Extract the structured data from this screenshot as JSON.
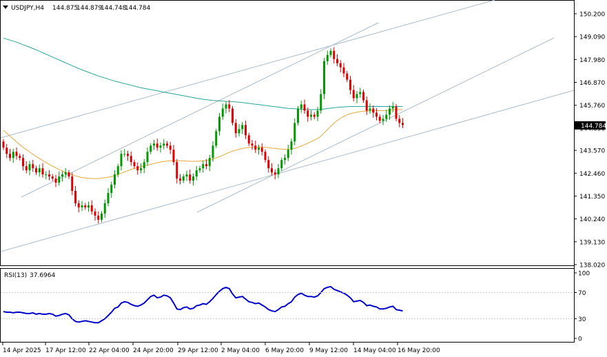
{
  "header": {
    "symbol": "USDJPY,H4",
    "open": "144.875",
    "high": "144.879",
    "low": "144.748",
    "close": "144.784"
  },
  "rsi_header": {
    "label": "RSI(13)",
    "value": "37.6964"
  },
  "current_price": "144.784",
  "colors": {
    "bull": "#009900",
    "bear": "#dd0000",
    "ma_fast": "#e8a83a",
    "ma_slow": "#26a69a",
    "trend": "#a9bccb",
    "rsi": "#0000cc",
    "price_box": "#000000"
  },
  "chart_data": {
    "type": "candlestick",
    "price_axis": {
      "ylim": [
        138.02,
        150.6
      ],
      "ticks": [
        "150.200",
        "149.090",
        "147.980",
        "146.870",
        "145.760",
        "144.650",
        "143.570",
        "142.460",
        "141.350",
        "140.240",
        "139.130",
        "138.020"
      ]
    },
    "rsi_axis": {
      "ylim": [
        0,
        100
      ],
      "ticks": [
        "100",
        "70",
        "30",
        "0"
      ]
    },
    "time_axis": {
      "labels": [
        "14 Apr 2025",
        "17 Apr 12:00",
        "22 Apr 04:00",
        "24 Apr 20:00",
        "29 Apr 12:00",
        "2 May 04:00",
        "6 May 20:00",
        "9 May 12:00",
        "14 May 04:00",
        "16 May 20:00"
      ]
    },
    "close": [
      143.7,
      143.4,
      143.2,
      143.5,
      143.3,
      143.2,
      142.8,
      142.6,
      142.9,
      142.7,
      142.5,
      142.7,
      142.4,
      142.4,
      142.3,
      142.2,
      142.0,
      142.3,
      142.4,
      142.5,
      142.3,
      141.6,
      141.0,
      140.8,
      140.9,
      140.8,
      140.9,
      140.6,
      140.4,
      140.2,
      140.5,
      141.0,
      141.5,
      141.9,
      142.4,
      142.8,
      143.4,
      143.4,
      143.3,
      143.0,
      142.8,
      142.6,
      142.7,
      143.0,
      143.5,
      143.8,
      143.9,
      143.7,
      143.8,
      143.9,
      143.8,
      143.6,
      143.0,
      142.2,
      142.1,
      142.3,
      142.4,
      142.1,
      142.3,
      142.6,
      142.7,
      142.9,
      142.8,
      143.2,
      143.8,
      144.5,
      145.2,
      145.6,
      145.8,
      145.6,
      144.9,
      144.4,
      144.6,
      144.8,
      144.3,
      143.9,
      143.8,
      143.6,
      143.7,
      143.5,
      143.1,
      142.7,
      142.5,
      142.4,
      142.7,
      143.1,
      143.2,
      143.6,
      144.0,
      144.9,
      145.6,
      145.8,
      145.5,
      145.2,
      145.3,
      145.2,
      145.5,
      146.3,
      147.9,
      148.2,
      148.4,
      148.0,
      147.8,
      147.6,
      147.3,
      147.0,
      146.5,
      146.1,
      146.3,
      146.4,
      146.0,
      145.5,
      145.6,
      145.4,
      145.2,
      145.0,
      145.1,
      145.3,
      145.6,
      145.7,
      145.1,
      144.9,
      144.8
    ],
    "ma_fast": [
      144.55,
      144.4,
      144.26,
      144.12,
      143.98,
      143.85,
      143.72,
      143.6,
      143.49,
      143.38,
      143.27,
      143.17,
      143.07,
      142.98,
      142.89,
      142.8,
      142.72,
      142.64,
      142.57,
      142.5,
      142.44,
      142.38,
      142.33,
      142.29,
      142.25,
      142.23,
      142.21,
      142.2,
      142.2,
      142.2,
      142.22,
      142.24,
      142.27,
      142.3,
      142.35,
      142.4,
      142.46,
      142.52,
      142.58,
      142.64,
      142.69,
      142.73,
      142.77,
      142.81,
      142.85,
      142.89,
      142.93,
      142.97,
      143.0,
      143.03,
      143.05,
      143.06,
      143.07,
      143.07,
      143.06,
      143.06,
      143.05,
      143.04,
      143.04,
      143.04,
      143.05,
      143.06,
      143.08,
      143.11,
      143.15,
      143.2,
      143.26,
      143.33,
      143.4,
      143.47,
      143.53,
      143.58,
      143.62,
      143.66,
      143.69,
      143.71,
      143.72,
      143.73,
      143.73,
      143.73,
      143.72,
      143.7,
      143.68,
      143.66,
      143.64,
      143.63,
      143.62,
      143.62,
      143.64,
      143.67,
      143.72,
      143.78,
      143.85,
      143.92,
      143.99,
      144.07,
      144.15,
      144.26,
      144.42,
      144.58,
      144.74,
      144.89,
      145.02,
      145.13,
      145.22,
      145.29,
      145.35,
      145.39,
      145.42,
      145.45,
      145.47,
      145.48,
      145.49,
      145.5,
      145.5,
      145.5,
      145.5,
      145.51,
      145.52,
      145.54,
      145.55,
      145.55,
      145.55
    ],
    "ma_slow": [
      149.02,
      148.97,
      148.92,
      148.87,
      148.82,
      148.76,
      148.7,
      148.64,
      148.58,
      148.51,
      148.45,
      148.38,
      148.31,
      148.24,
      148.17,
      148.1,
      148.03,
      147.96,
      147.89,
      147.82,
      147.75,
      147.68,
      147.61,
      147.54,
      147.48,
      147.42,
      147.36,
      147.3,
      147.24,
      147.18,
      147.13,
      147.08,
      147.03,
      146.98,
      146.93,
      146.89,
      146.85,
      146.81,
      146.77,
      146.73,
      146.69,
      146.65,
      146.61,
      146.58,
      146.55,
      146.52,
      146.49,
      146.46,
      146.43,
      146.4,
      146.37,
      146.34,
      146.31,
      146.28,
      146.25,
      146.22,
      146.19,
      146.16,
      146.13,
      146.1,
      146.07,
      146.05,
      146.03,
      146.01,
      145.99,
      145.98,
      145.97,
      145.96,
      145.95,
      145.94,
      145.93,
      145.92,
      145.91,
      145.89,
      145.87,
      145.85,
      145.83,
      145.81,
      145.79,
      145.77,
      145.75,
      145.73,
      145.71,
      145.69,
      145.67,
      145.65,
      145.63,
      145.61,
      145.6,
      145.59,
      145.58,
      145.57,
      145.56,
      145.55,
      145.55,
      145.55,
      145.55,
      145.56,
      145.58,
      145.6,
      145.62,
      145.64,
      145.66,
      145.67,
      145.68,
      145.69,
      145.7,
      145.7,
      145.7,
      145.7,
      145.7,
      145.7,
      145.7,
      145.7,
      145.7,
      145.7,
      145.7,
      145.7,
      145.7,
      145.7,
      145.7,
      145.7,
      145.7
    ],
    "rsi": [
      41,
      40,
      40,
      39,
      40,
      40,
      39,
      38,
      38,
      39,
      37,
      38,
      37,
      37,
      38,
      37,
      34,
      35,
      37,
      38,
      36,
      30,
      26,
      25,
      26,
      27,
      26,
      25,
      24,
      24,
      27,
      30,
      35,
      40,
      46,
      48,
      54,
      56,
      55,
      52,
      50,
      49,
      51,
      54,
      59,
      64,
      66,
      62,
      63,
      66,
      65,
      62,
      54,
      45,
      44,
      47,
      48,
      45,
      46,
      50,
      51,
      53,
      52,
      56,
      61,
      67,
      72,
      76,
      78,
      76,
      68,
      62,
      63,
      64,
      60,
      56,
      55,
      53,
      54,
      51,
      48,
      44,
      42,
      41,
      44,
      48,
      49,
      53,
      56,
      63,
      67,
      69,
      66,
      64,
      64,
      63,
      65,
      70,
      76,
      78,
      79,
      75,
      73,
      71,
      69,
      66,
      62,
      56,
      57,
      58,
      55,
      50,
      51,
      49,
      48,
      45,
      45,
      46,
      48,
      49,
      44,
      43,
      42
    ],
    "trendlines_note": "ascending channel and rising support lines"
  }
}
